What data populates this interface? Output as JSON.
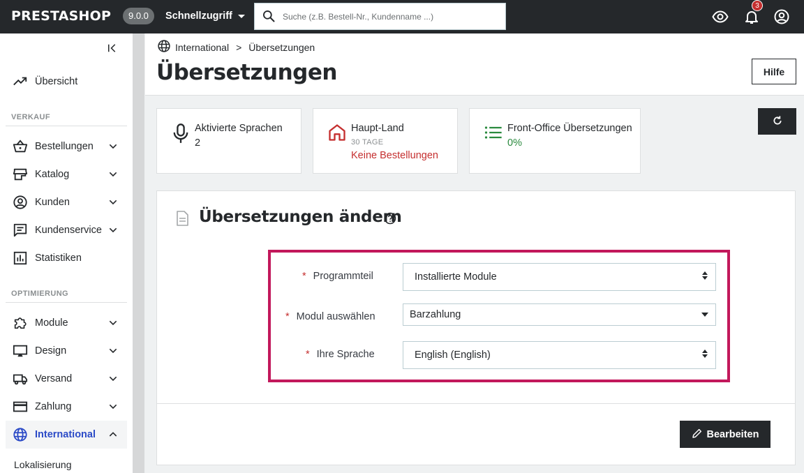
{
  "header": {
    "logo": "PRESTASHOP",
    "version": "9.0.0",
    "quick_access": "Schnellzugriff",
    "search_placeholder": "Suche (z.B. Bestell-Nr., Kundenname ...)",
    "notification_count": "3"
  },
  "sidebar": {
    "items": [
      {
        "label": "Übersicht",
        "icon": "trending-up-icon"
      },
      {
        "section": "VERKAUF"
      },
      {
        "label": "Bestellungen",
        "icon": "shopping-basket-icon"
      },
      {
        "label": "Katalog",
        "icon": "store-icon"
      },
      {
        "label": "Kunden",
        "icon": "account-circle-icon"
      },
      {
        "label": "Kundenservice",
        "icon": "chat-icon"
      },
      {
        "label": "Statistiken",
        "icon": "bar-chart-icon"
      },
      {
        "section": "OPTIMIERUNG"
      },
      {
        "label": "Module",
        "icon": "puzzle-icon"
      },
      {
        "label": "Design",
        "icon": "desktop-icon"
      },
      {
        "label": "Versand",
        "icon": "truck-icon"
      },
      {
        "label": "Zahlung",
        "icon": "credit-card-icon"
      },
      {
        "label": "International",
        "icon": "globe-icon",
        "active": true
      }
    ],
    "sections": {
      "sales": "VERKAUF",
      "optimization": "OPTIMIERUNG"
    },
    "labels": {
      "overview": "Übersicht",
      "orders": "Bestellungen",
      "catalog": "Katalog",
      "customers": "Kunden",
      "service": "Kundenservice",
      "stats": "Statistiken",
      "modules": "Module",
      "design": "Design",
      "shipping": "Versand",
      "payment": "Zahlung",
      "international": "International"
    },
    "subitem": "Lokalisierung"
  },
  "page": {
    "breadcrumb": [
      "International",
      "Übersetzungen"
    ],
    "breadcrumb_sep": ">",
    "title": "Übersetzungen",
    "help_label": "Hilfe"
  },
  "kpis": [
    {
      "title": "Aktivierte Sprachen",
      "value": "2"
    },
    {
      "title": "Haupt-Land",
      "sub": "30 TAGE",
      "value": "Keine Bestellungen"
    },
    {
      "title": "Front-Office Übersetzungen",
      "value": "0%"
    }
  ],
  "panel": {
    "title": "Übersetzungen ändern",
    "fields": [
      {
        "label": "Programmteil",
        "value": "Installierte Module"
      },
      {
        "label": "Modul auswählen",
        "value": "Barzahlung"
      },
      {
        "label": "Ihre Sprache",
        "value": "English (English)"
      }
    ],
    "required_mark": "*",
    "edit_label": "Bearbeiten"
  },
  "colors": {
    "accent": "#2c4bc7",
    "danger": "#c52f2f",
    "success": "#2a8a3e",
    "highlight": "#c2185b",
    "dark": "#25282b"
  }
}
